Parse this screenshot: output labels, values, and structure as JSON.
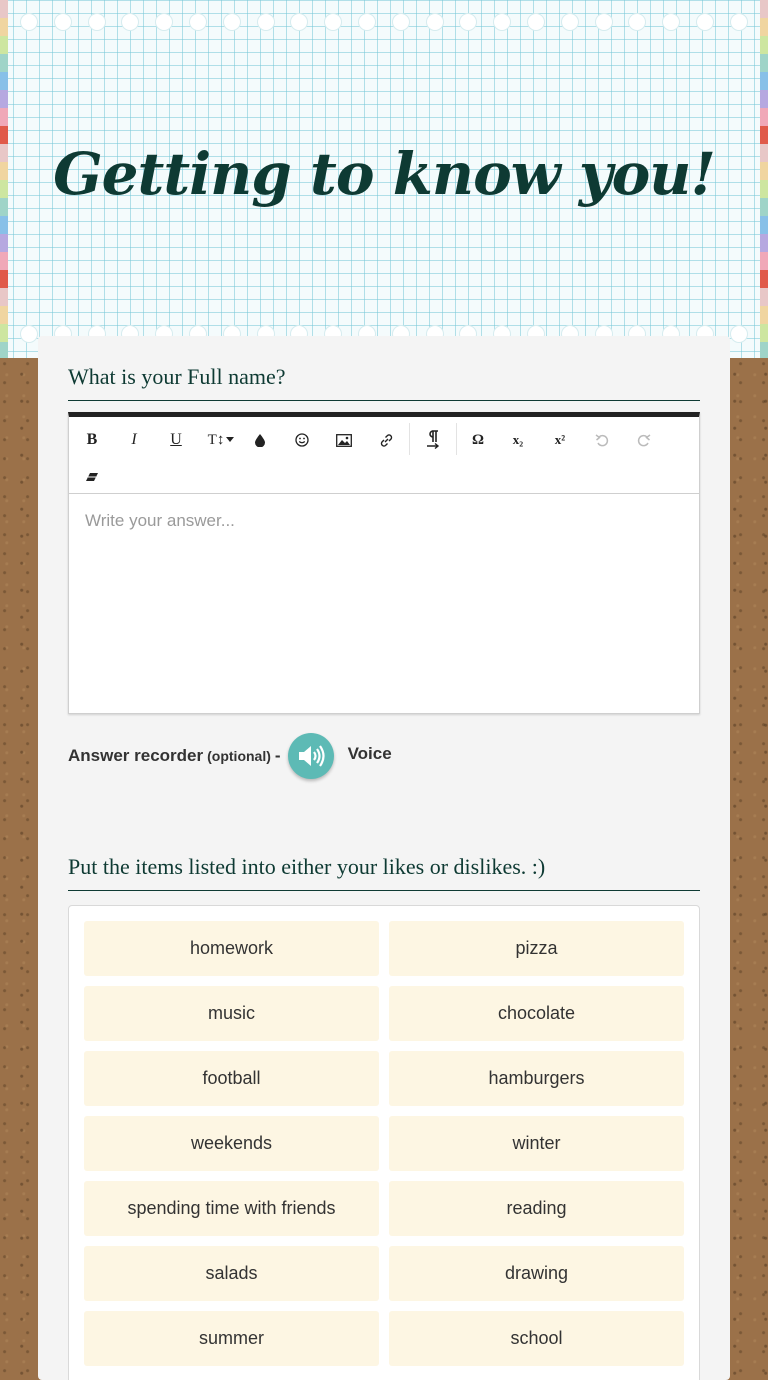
{
  "header": {
    "title": "Getting to know you!"
  },
  "question1": {
    "title": "What is your Full name?",
    "toolbar": {
      "bold": "B",
      "italic": "I",
      "underline": "U",
      "text_size": "T↕",
      "omega": "Ω",
      "subscript": "x₂",
      "superscript": "x²"
    },
    "answer_placeholder": "Write your answer...",
    "recorder": {
      "label": "Answer recorder",
      "optional": "(optional)",
      "dash": "-",
      "voice": "Voice"
    }
  },
  "question2": {
    "title": "Put the items listed into either your likes or dislikes. :)",
    "items": [
      "homework",
      "pizza",
      "music",
      "chocolate",
      "football",
      "hamburgers",
      "weekends",
      "winter",
      "spending time with friends",
      "reading",
      "salads",
      "drawing",
      "summer",
      "school"
    ]
  },
  "colors": {
    "accent": "#0e3a33",
    "mic": "#5dbab5",
    "item_bg": "#fdf6e3"
  }
}
